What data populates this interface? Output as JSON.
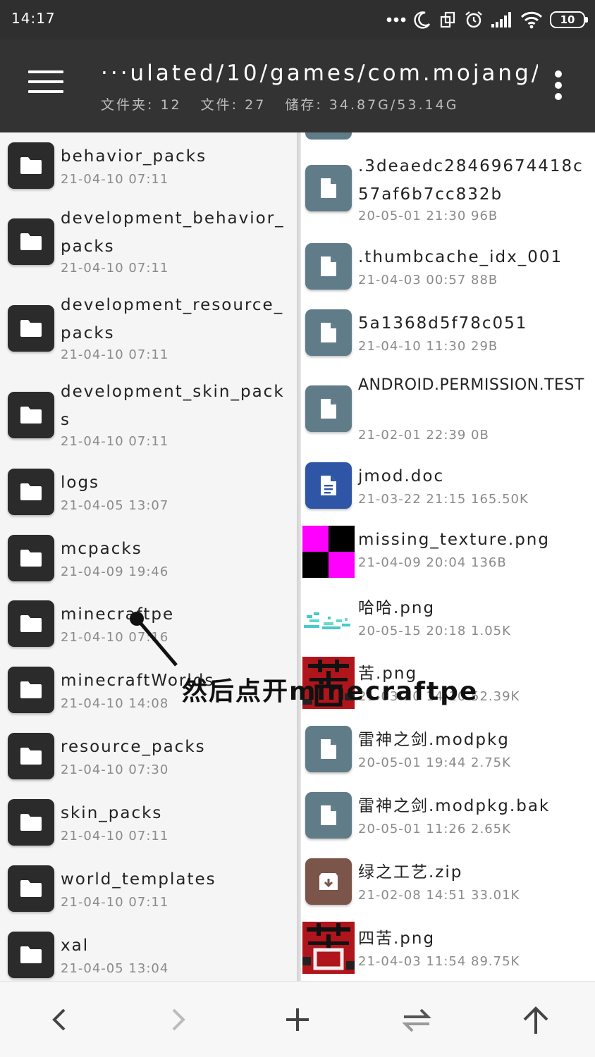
{
  "status_bar": {
    "time": "14:17",
    "battery": "10"
  },
  "app_bar": {
    "path": "···ulated/10/games/com.mojang/",
    "folders_label": "文件夹: 12",
    "files_label": "文件: 27",
    "storage_label": "储存: 34.87G/53.14G"
  },
  "left_panel": {
    "items": [
      {
        "name": "behavior_packs",
        "meta": "21-04-10 07:11"
      },
      {
        "name": "development_behavior_packs",
        "meta": "21-04-10 07:11"
      },
      {
        "name": "development_resource_packs",
        "meta": "21-04-10 07:11"
      },
      {
        "name": "development_skin_packs",
        "meta": "21-04-10 07:11"
      },
      {
        "name": "logs",
        "meta": "21-04-05 13:07"
      },
      {
        "name": "mcpacks",
        "meta": "21-04-09 19:46"
      },
      {
        "name": "minecraftpe",
        "meta": "21-04-10 07:16"
      },
      {
        "name": "minecraftWorlds",
        "meta": "21-04-10 14:08"
      },
      {
        "name": "resource_packs",
        "meta": "21-04-10 07:30"
      },
      {
        "name": "skin_packs",
        "meta": "21-04-10 07:11"
      },
      {
        "name": "world_templates",
        "meta": "21-04-10 07:11"
      },
      {
        "name": "xal",
        "meta": "21-04-05 13:04"
      }
    ]
  },
  "right_panel": {
    "items": [
      {
        "name": ".3deaedc28469674418c57af6b7cc832b",
        "meta": "20-05-01 21:30  96B",
        "icon": "file-icon"
      },
      {
        "name": ".thumbcache_idx_001",
        "meta": "21-04-03 00:57  88B",
        "icon": "file-icon"
      },
      {
        "name": "5a1368d5f78c051",
        "meta": "21-04-10 11:30  29B",
        "icon": "file-icon"
      },
      {
        "name": "ANDROID.PERMISSION.TEST",
        "meta": "21-02-01 22:39  0B",
        "icon": "file-icon"
      },
      {
        "name": "jmod.doc",
        "meta": "21-03-22 21:15  165.50K",
        "icon": "doc-icon"
      },
      {
        "name": "missing_texture.png",
        "meta": "21-04-09 20:04  136B",
        "icon": "image-thumbnail"
      },
      {
        "name": "哈哈.png",
        "meta": "20-05-15 20:18  1.05K",
        "icon": "image-thumbnail"
      },
      {
        "name": "苦.png",
        "meta": "21-03-20 14:10  52.39K",
        "icon": "image-thumbnail"
      },
      {
        "name": "雷神之剑.modpkg",
        "meta": "20-05-01 19:44  2.75K",
        "icon": "file-icon"
      },
      {
        "name": "雷神之剑.modpkg.bak",
        "meta": "20-05-01 11:26  2.65K",
        "icon": "file-icon"
      },
      {
        "name": "绿之工艺.zip",
        "meta": "21-02-08 14:51  33.01K",
        "icon": "archive-icon"
      },
      {
        "name": "四苦.png",
        "meta": "21-04-03 11:54  89.75K",
        "icon": "image-thumbnail"
      }
    ]
  },
  "annotation": {
    "text": "然后点开minecraftpe"
  },
  "colors": {
    "app_bar": "#333333",
    "folder_icon_bg": "#2b2b2b",
    "file_icon_bg": "#617c89",
    "doc_icon_bg": "#2f55a6",
    "zip_icon_bg": "#7b5549",
    "texture_magenta": "#ff00ff"
  }
}
